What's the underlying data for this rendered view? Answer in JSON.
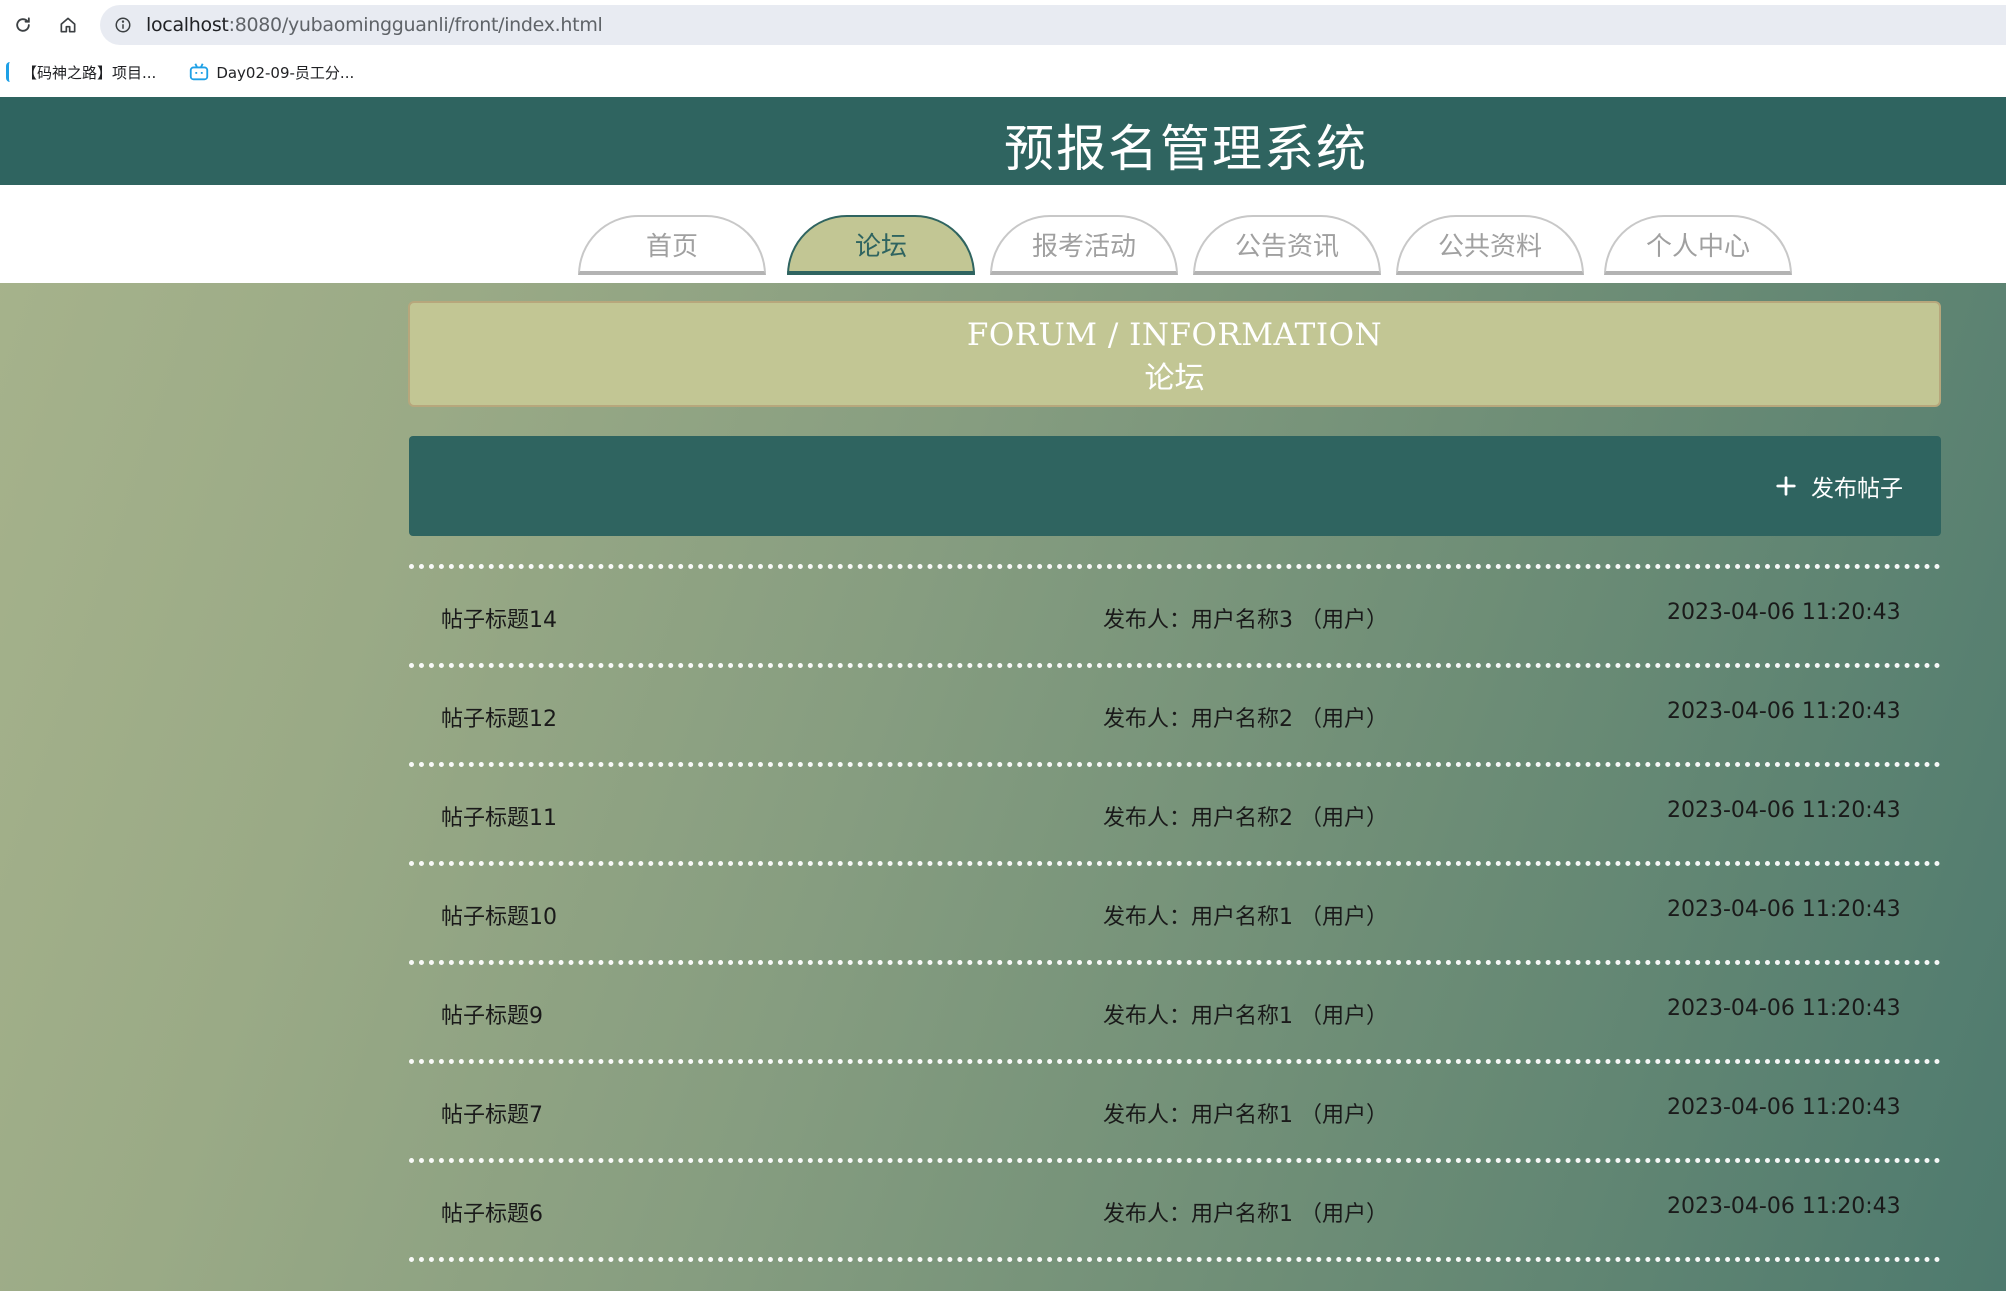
{
  "browser": {
    "url_host": "localhost",
    "url_rest": ":8080/yubaomingguanli/front/index.html",
    "bookmarks": [
      {
        "label": "【码神之路】项目..."
      },
      {
        "label": "Day02-09-员工分..."
      }
    ]
  },
  "site": {
    "title": "预报名管理系统"
  },
  "nav": {
    "tabs": [
      {
        "label": "首页"
      },
      {
        "label": "论坛"
      },
      {
        "label": "报考活动"
      },
      {
        "label": "公告资讯"
      },
      {
        "label": "公共资料"
      },
      {
        "label": "个人中心"
      }
    ],
    "active_index": 1
  },
  "section": {
    "title_en": "FORUM / INFORMATION",
    "title_cn": "论坛"
  },
  "actions": {
    "add_post_label": "发布帖子"
  },
  "posts": [
    {
      "title": "帖子标题14",
      "author": "发布人：用户名称3 （用户）",
      "time": "2023-04-06 11:20:43"
    },
    {
      "title": "帖子标题12",
      "author": "发布人：用户名称2 （用户）",
      "time": "2023-04-06 11:20:43"
    },
    {
      "title": "帖子标题11",
      "author": "发布人：用户名称2 （用户）",
      "time": "2023-04-06 11:20:43"
    },
    {
      "title": "帖子标题10",
      "author": "发布人：用户名称1 （用户）",
      "time": "2023-04-06 11:20:43"
    },
    {
      "title": "帖子标题9",
      "author": "发布人：用户名称1 （用户）",
      "time": "2023-04-06 11:20:43"
    },
    {
      "title": "帖子标题7",
      "author": "发布人：用户名称1 （用户）",
      "time": "2023-04-06 11:20:43"
    },
    {
      "title": "帖子标题6",
      "author": "发布人：用户名称1 （用户）",
      "time": "2023-04-06 11:20:43"
    }
  ],
  "colors": {
    "header_bg": "#2f6460",
    "accent": "#c2c694",
    "tab_inactive_text": "#a0a0a0"
  }
}
